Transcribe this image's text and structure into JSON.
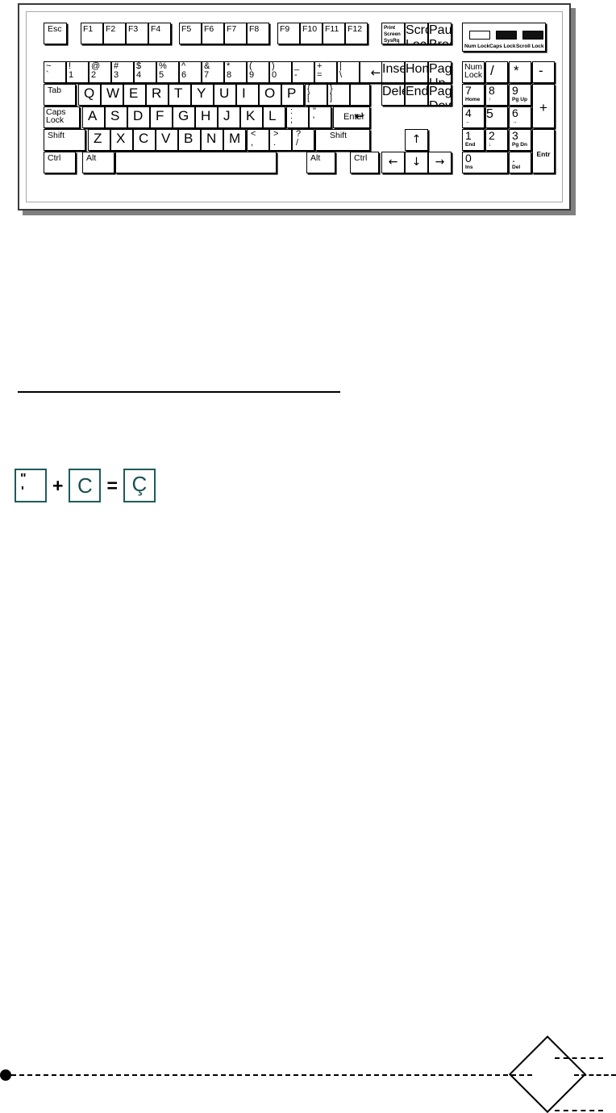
{
  "figure": {
    "name": "keyboard-diagram",
    "type": "qwerty-104-key-layout"
  },
  "keyboard": {
    "escape": {
      "label": "Esc"
    },
    "function_keys": [
      {
        "label": "F1"
      },
      {
        "label": "F2"
      },
      {
        "label": "F3"
      },
      {
        "label": "F4"
      },
      {
        "label": "F5"
      },
      {
        "label": "F6"
      },
      {
        "label": "F7"
      },
      {
        "label": "F8"
      },
      {
        "label": "F9"
      },
      {
        "label": "F10"
      },
      {
        "label": "F11"
      },
      {
        "label": "F12"
      }
    ],
    "system_keys": [
      {
        "line1": "Print",
        "line2": "Screen",
        "line3": "SysRq"
      },
      {
        "line1": "Scroll",
        "line2": "Lock"
      },
      {
        "line1": "Pause",
        "line2": "Break"
      }
    ],
    "indicators": {
      "leds": [
        {
          "label": "Num Lock",
          "state": "off"
        },
        {
          "label": "Caps Lock",
          "state": "on"
        },
        {
          "label": "Scroll Lock",
          "state": "on"
        }
      ]
    },
    "number_row": [
      {
        "shift": "~",
        "base": "`"
      },
      {
        "shift": "!",
        "base": "1"
      },
      {
        "shift": "@",
        "base": "2"
      },
      {
        "shift": "#",
        "base": "3"
      },
      {
        "shift": "$",
        "base": "4"
      },
      {
        "shift": "%",
        "base": "5"
      },
      {
        "shift": "^",
        "base": "6"
      },
      {
        "shift": "&",
        "base": "7"
      },
      {
        "shift": "*",
        "base": "8"
      },
      {
        "shift": "(",
        "base": "9"
      },
      {
        "shift": ")",
        "base": "0"
      },
      {
        "shift": "_",
        "base": "-"
      },
      {
        "shift": "+",
        "base": "="
      },
      {
        "shift": "|",
        "base": "\\"
      }
    ],
    "backspace": {
      "label": "←"
    },
    "tab": {
      "label": "Tab"
    },
    "top_row": [
      {
        "label": "Q"
      },
      {
        "label": "W"
      },
      {
        "label": "E"
      },
      {
        "label": "R"
      },
      {
        "label": "T"
      },
      {
        "label": "Y"
      },
      {
        "label": "U"
      },
      {
        "label": "I"
      },
      {
        "label": "O"
      },
      {
        "label": "P"
      }
    ],
    "top_row_punct": [
      {
        "shift": "{",
        "base": "["
      },
      {
        "shift": "}",
        "base": "]"
      }
    ],
    "caps_lock": {
      "line1": "Caps",
      "line2": "Lock"
    },
    "home_row": [
      {
        "label": "A"
      },
      {
        "label": "S"
      },
      {
        "label": "D"
      },
      {
        "label": "F"
      },
      {
        "label": "G"
      },
      {
        "label": "H"
      },
      {
        "label": "J"
      },
      {
        "label": "K"
      },
      {
        "label": "L"
      }
    ],
    "home_row_punct": [
      {
        "shift": ":",
        "base": ";"
      },
      {
        "shift": "\"",
        "base": "'"
      }
    ],
    "enter": {
      "label": "Enter",
      "glyph": "↵"
    },
    "shift_left": {
      "label": "Shift"
    },
    "bottom_row": [
      {
        "label": "Z"
      },
      {
        "label": "X"
      },
      {
        "label": "C"
      },
      {
        "label": "V"
      },
      {
        "label": "B"
      },
      {
        "label": "N"
      },
      {
        "label": "M"
      }
    ],
    "bottom_row_punct": [
      {
        "shift": "<",
        "base": ","
      },
      {
        "shift": ">",
        "base": "."
      },
      {
        "shift": "?",
        "base": "/"
      }
    ],
    "shift_right": {
      "label": "Shift"
    },
    "modifier_row": {
      "ctrl_left": "Ctrl",
      "alt_left": "Alt",
      "space": "",
      "alt_right": "Alt",
      "ctrl_right": "Ctrl"
    },
    "nav_cluster": [
      {
        "line1": "Insert"
      },
      {
        "line1": "Home"
      },
      {
        "line1": "Page",
        "line2": "Up"
      },
      {
        "line1": "Delete"
      },
      {
        "line1": "End"
      },
      {
        "line1": "Page",
        "line2": "Down"
      }
    ],
    "arrow_keys": {
      "up": "↑",
      "left": "←",
      "down": "↓",
      "right": "→"
    },
    "numpad": {
      "num_lock": {
        "line1": "Num",
        "line2": "Lock"
      },
      "divide": "/",
      "multiply": "*",
      "minus": "-",
      "plus": "+",
      "enter": "Entr",
      "keys": [
        {
          "num": "7",
          "sub": "Home"
        },
        {
          "num": "8",
          "sub": "↑"
        },
        {
          "num": "9",
          "sub": "Pg Up"
        },
        {
          "num": "4",
          "sub": "←"
        },
        {
          "num": "5",
          "sub": ""
        },
        {
          "num": "6",
          "sub": "→"
        },
        {
          "num": "1",
          "sub": "End"
        },
        {
          "num": "2",
          "sub": "↓"
        },
        {
          "num": "3",
          "sub": "Pg Dn"
        },
        {
          "num": "0",
          "sub": "Ins"
        },
        {
          "num": ".",
          "sub": "Del"
        }
      ]
    }
  },
  "dead_key_example": {
    "dead_key": {
      "top": "\"",
      "bottom": "'"
    },
    "plus": "+",
    "letter_key": "C",
    "equals": "=",
    "result_key": "Ç"
  },
  "colors": {
    "key_border": "#000000",
    "keyboard_frame": "#3a3a3a",
    "keyboard_inner_frame": "#a8a8a8",
    "keyboard_shadow": "#7f7f7f",
    "example_key_border": "#1d5b5b",
    "example_glyph": "#18504f",
    "led_on": "#111111",
    "led_off": "#ffffff"
  }
}
